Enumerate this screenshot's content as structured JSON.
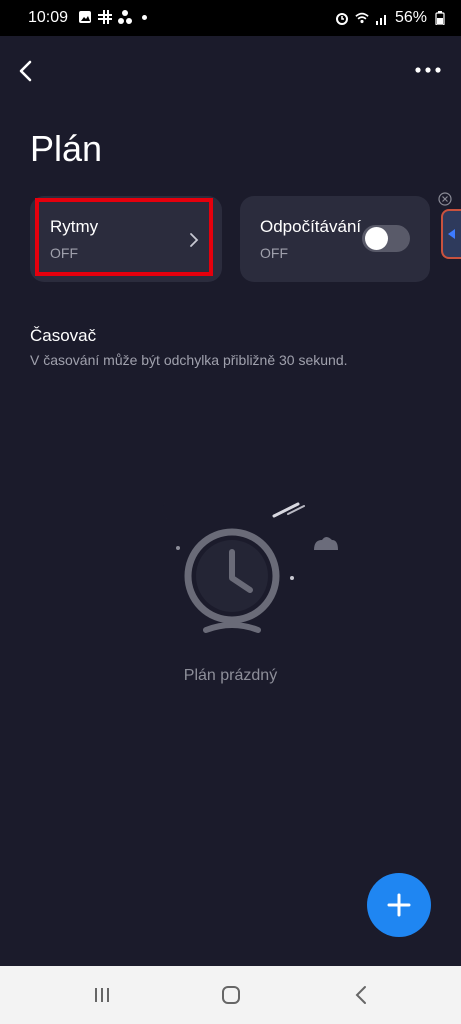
{
  "status_bar": {
    "time": "10:09",
    "battery": "56%",
    "icons": [
      "gallery-icon",
      "slack-icon",
      "nodes-icon",
      "notification-dot",
      "alarm-icon",
      "wifi-icon",
      "signal-icon",
      "battery-icon"
    ]
  },
  "header": {
    "back_icon": "back-arrow-icon",
    "more_icon": "more-options-icon"
  },
  "page": {
    "title": "Plán"
  },
  "cards": {
    "rhythm": {
      "title": "Rytmy",
      "status": "OFF",
      "highlight_color": "#e5000d"
    },
    "countdown": {
      "title": "Odpočítávání",
      "status": "OFF",
      "toggle_on": false
    }
  },
  "timer": {
    "heading": "Časovač",
    "note": "V časování může být odchylka přibližně 30 sekund."
  },
  "empty_state": {
    "text": "Plán prázdný",
    "illustration": "clock-night-icon"
  },
  "fab": {
    "icon": "plus-icon",
    "color": "#1f86f2"
  },
  "colors": {
    "background": "#1b1b2b",
    "card": "#2b2c3d",
    "accent": "#1f86f2"
  },
  "system_nav": {
    "icons": [
      "recent-apps-icon",
      "home-icon",
      "back-icon"
    ]
  }
}
